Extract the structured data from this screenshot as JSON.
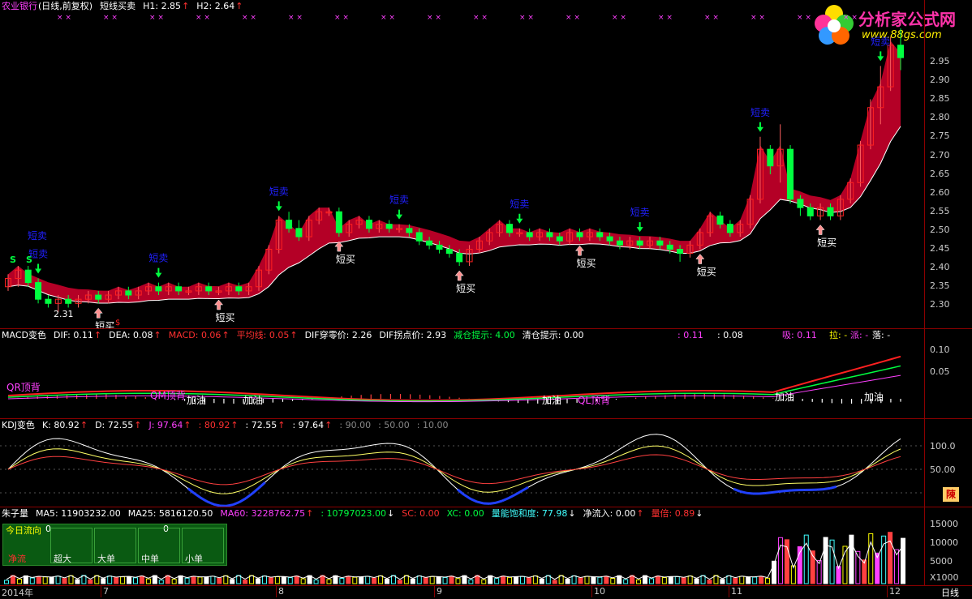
{
  "colors": {
    "up": "#ff2020",
    "down": "#00ff40",
    "band": "#c8002a",
    "axis": "#8b0000",
    "blue": "#2020ff",
    "yellow": "#ffff00",
    "magenta": "#ff40ff",
    "cyan": "#40ffff"
  },
  "main_header": {
    "stock": "农业银行",
    "mode": "(日线,前复权)",
    "indicator": "短线买卖",
    "h1": "H1: 2.85",
    "h2": "H2: 2.64"
  },
  "logo": {
    "title": "分析家公式网",
    "url": "www.88gs.com"
  },
  "price_axis": [
    "2.95",
    "2.90",
    "2.85",
    "2.80",
    "2.75",
    "2.70",
    "2.65",
    "2.60",
    "2.55",
    "2.50",
    "2.45",
    "2.40",
    "2.35",
    "2.30"
  ],
  "price_low_label": "2.31",
  "sell_label": "短卖",
  "buy_label": "短买",
  "sell_signal_s": "S",
  "dollar": "$",
  "macd_header": {
    "name": "MACD变色",
    "dif": "DIF: 0.11",
    "dea": "DEA: 0.08",
    "macd": "MACD: 0.06",
    "avg": "平均线: 0.05",
    "dif_zero": "DIF穿零价: 2.26",
    "dif_turn": "DIF拐点价: 2.93",
    "reduce": "减仓提示: 4.00",
    "clear": "清仓提示: 0.00",
    "v1": ": 0.11",
    "v2": ": 0.08",
    "xi": "吸: 0.11",
    "la": "拉: -",
    "pai": "派: -",
    "luo": "落: -"
  },
  "macd_axis": [
    "0.10",
    "0.05"
  ],
  "macd_annotations": {
    "jia_you": "加油",
    "qr_top": "QR顶背",
    "qm": "QM顶背",
    "ql": "QL顶背"
  },
  "kdj_header": {
    "name": "KDJ变色",
    "k": "K: 80.92",
    "d": "D: 72.55",
    "j": "J: 97.64",
    "v1": ": 80.92",
    "v2": ": 72.55",
    "v3": ": 97.64",
    "v4": ": 90.00",
    "v5": ": 50.00",
    "v6": ": 10.00"
  },
  "kdj_axis": [
    "100.0",
    "50.00"
  ],
  "kdj_badge": "陳",
  "vol_header": {
    "name": "朱子量",
    "ma5": "MA5: 11903232.00",
    "ma25": "MA25: 5816120.50",
    "ma60": "MA60: 3228762.75",
    "v1": ": 10797023.00",
    "sc": "SC: 0.00",
    "xc": "XC: 0.00",
    "sat": "量能饱和度: 77.98",
    "inflow": "净流入: 0.00",
    "ratio": "量倍: 0.89"
  },
  "vol_axis": [
    "15000",
    "10000",
    "5000"
  ],
  "vol_unit": "X1000",
  "flow_box": {
    "title": "今日流向",
    "title_val": "0",
    "cell_val": "0",
    "cells": [
      "净流",
      "超大",
      "大单",
      "中单",
      "小单"
    ]
  },
  "dates": [
    {
      "label": "2014年"
    },
    {
      "label": "7"
    },
    {
      "label": "8"
    },
    {
      "label": "9"
    },
    {
      "label": "10"
    },
    {
      "label": "11"
    },
    {
      "label": "12"
    }
  ],
  "period": "日线",
  "chart_data": {
    "type": "candlestick",
    "title": "短线买卖",
    "ylim": [
      2.28,
      3.0
    ],
    "candles": [
      [
        2.37,
        2.39,
        2.36,
        2.4
      ],
      [
        2.39,
        2.41,
        2.37,
        2.42
      ],
      [
        2.41,
        2.38,
        2.37,
        2.42
      ],
      [
        2.38,
        2.34,
        2.33,
        2.39
      ],
      [
        2.34,
        2.33,
        2.32,
        2.35
      ],
      [
        2.33,
        2.34,
        2.31,
        2.35
      ],
      [
        2.34,
        2.33,
        2.32,
        2.35
      ],
      [
        2.33,
        2.34,
        2.32,
        2.35
      ],
      [
        2.34,
        2.35,
        2.33,
        2.36
      ],
      [
        2.35,
        2.34,
        2.33,
        2.36
      ],
      [
        2.34,
        2.35,
        2.33,
        2.36
      ],
      [
        2.35,
        2.36,
        2.34,
        2.37
      ],
      [
        2.36,
        2.35,
        2.34,
        2.37
      ],
      [
        2.35,
        2.36,
        2.34,
        2.37
      ],
      [
        2.36,
        2.37,
        2.35,
        2.38
      ],
      [
        2.37,
        2.36,
        2.35,
        2.38
      ],
      [
        2.36,
        2.37,
        2.35,
        2.38
      ],
      [
        2.37,
        2.36,
        2.35,
        2.38
      ],
      [
        2.36,
        2.36,
        2.35,
        2.37
      ],
      [
        2.36,
        2.37,
        2.35,
        2.38
      ],
      [
        2.37,
        2.36,
        2.35,
        2.38
      ],
      [
        2.36,
        2.36,
        2.35,
        2.37
      ],
      [
        2.36,
        2.37,
        2.35,
        2.38
      ],
      [
        2.37,
        2.36,
        2.35,
        2.38
      ],
      [
        2.36,
        2.37,
        2.35,
        2.38
      ],
      [
        2.37,
        2.41,
        2.36,
        2.42
      ],
      [
        2.41,
        2.46,
        2.4,
        2.47
      ],
      [
        2.46,
        2.53,
        2.45,
        2.54
      ],
      [
        2.53,
        2.51,
        2.5,
        2.55
      ],
      [
        2.51,
        2.49,
        2.48,
        2.53
      ],
      [
        2.49,
        2.53,
        2.48,
        2.54
      ],
      [
        2.53,
        2.55,
        2.52,
        2.56
      ],
      [
        2.55,
        2.55,
        2.54,
        2.56
      ],
      [
        2.55,
        2.5,
        2.49,
        2.56
      ],
      [
        2.5,
        2.52,
        2.49,
        2.53
      ],
      [
        2.52,
        2.53,
        2.51,
        2.54
      ],
      [
        2.53,
        2.51,
        2.5,
        2.54
      ],
      [
        2.51,
        2.52,
        2.5,
        2.53
      ],
      [
        2.52,
        2.51,
        2.5,
        2.53
      ],
      [
        2.51,
        2.51,
        2.5,
        2.52
      ],
      [
        2.51,
        2.5,
        2.49,
        2.52
      ],
      [
        2.5,
        2.48,
        2.47,
        2.51
      ],
      [
        2.48,
        2.47,
        2.46,
        2.49
      ],
      [
        2.47,
        2.46,
        2.45,
        2.48
      ],
      [
        2.46,
        2.45,
        2.44,
        2.47
      ],
      [
        2.45,
        2.43,
        2.42,
        2.46
      ],
      [
        2.43,
        2.46,
        2.42,
        2.47
      ],
      [
        2.46,
        2.48,
        2.45,
        2.49
      ],
      [
        2.48,
        2.5,
        2.47,
        2.51
      ],
      [
        2.5,
        2.52,
        2.49,
        2.53
      ],
      [
        2.52,
        2.5,
        2.49,
        2.53
      ],
      [
        2.5,
        2.5,
        2.49,
        2.51
      ],
      [
        2.5,
        2.49,
        2.48,
        2.51
      ],
      [
        2.49,
        2.5,
        2.48,
        2.51
      ],
      [
        2.5,
        2.49,
        2.48,
        2.51
      ],
      [
        2.49,
        2.48,
        2.47,
        2.5
      ],
      [
        2.48,
        2.5,
        2.47,
        2.51
      ],
      [
        2.5,
        2.49,
        2.48,
        2.51
      ],
      [
        2.49,
        2.5,
        2.48,
        2.51
      ],
      [
        2.5,
        2.49,
        2.48,
        2.51
      ],
      [
        2.49,
        2.48,
        2.47,
        2.5
      ],
      [
        2.48,
        2.47,
        2.46,
        2.49
      ],
      [
        2.47,
        2.48,
        2.46,
        2.49
      ],
      [
        2.48,
        2.47,
        2.46,
        2.49
      ],
      [
        2.47,
        2.48,
        2.46,
        2.49
      ],
      [
        2.48,
        2.47,
        2.46,
        2.49
      ],
      [
        2.47,
        2.46,
        2.45,
        2.48
      ],
      [
        2.46,
        2.45,
        2.43,
        2.47
      ],
      [
        2.45,
        2.47,
        2.44,
        2.48
      ],
      [
        2.47,
        2.5,
        2.46,
        2.51
      ],
      [
        2.5,
        2.54,
        2.49,
        2.55
      ],
      [
        2.54,
        2.52,
        2.51,
        2.55
      ],
      [
        2.52,
        2.5,
        2.49,
        2.53
      ],
      [
        2.5,
        2.52,
        2.49,
        2.53
      ],
      [
        2.52,
        2.58,
        2.51,
        2.59
      ],
      [
        2.58,
        2.7,
        2.57,
        2.73
      ],
      [
        2.7,
        2.66,
        2.64,
        2.71
      ],
      [
        2.66,
        2.7,
        2.62,
        2.76
      ],
      [
        2.7,
        2.58,
        2.57,
        2.71
      ],
      [
        2.58,
        2.56,
        2.54,
        2.59
      ],
      [
        2.56,
        2.54,
        2.53,
        2.57
      ],
      [
        2.54,
        2.56,
        2.53,
        2.57
      ],
      [
        2.56,
        2.54,
        2.53,
        2.57
      ],
      [
        2.54,
        2.58,
        2.53,
        2.59
      ],
      [
        2.58,
        2.62,
        2.57,
        2.63
      ],
      [
        2.62,
        2.71,
        2.61,
        2.72
      ],
      [
        2.71,
        2.8,
        2.7,
        2.82
      ],
      [
        2.8,
        2.85,
        2.76,
        2.9
      ],
      [
        2.85,
        2.95,
        2.84,
        2.97
      ],
      [
        2.95,
        2.92,
        2.89,
        2.99
      ]
    ]
  }
}
